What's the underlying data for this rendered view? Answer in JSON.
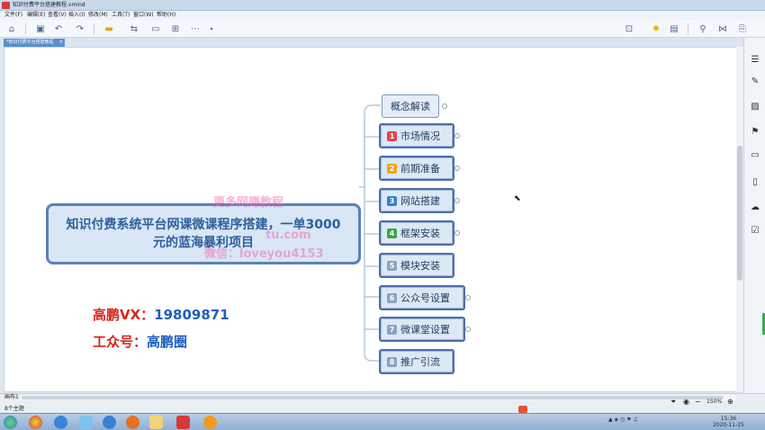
{
  "window": {
    "title": "知识付费平台搭建教程.xmind"
  },
  "menu": [
    "文件(F)",
    "编辑(E)",
    "查看(V)",
    "插入(I)",
    "修改(M)",
    "工具(T)",
    "窗口(W)",
    "帮助(H)"
  ],
  "tab": {
    "label": "*知识付费平台搭建教程",
    "close": "✕"
  },
  "central_topic": {
    "text": "知识付费系统平台网课微课程序搭建，一单3000元的蓝海暴利项目"
  },
  "branches": [
    {
      "num": "",
      "label": "概念解读"
    },
    {
      "num": "1",
      "label": "市场情况",
      "color": "#e0474c"
    },
    {
      "num": "2",
      "label": "前期准备",
      "color": "#f2a516"
    },
    {
      "num": "3",
      "label": "网站搭建",
      "color": "#3a7fd5"
    },
    {
      "num": "4",
      "label": "框架安装",
      "color": "#3aa84a"
    },
    {
      "num": "5",
      "label": "模块安装",
      "color": "#8aa3bf"
    },
    {
      "num": "6",
      "label": "公众号设置",
      "color": "#8aa3bf"
    },
    {
      "num": "7",
      "label": "微课堂设置",
      "color": "#8aa3bf"
    },
    {
      "num": "8",
      "label": "推广引流",
      "color": "#8aa3bf"
    }
  ],
  "contacts": {
    "vx_label": "高鹏VX：",
    "vx_value": "19809871",
    "gzh_label": "工众号：",
    "gzh_value": "高鹏圈"
  },
  "watermark": {
    "line1": "更多网赚教程",
    "line2": "tu.com",
    "line3": "微信：loveyou4153"
  },
  "status": {
    "sheet_label": "画布1",
    "topics": "8个主题",
    "zoom": "150%"
  },
  "clock": {
    "time": "15:36",
    "date": "2020-11-25"
  }
}
